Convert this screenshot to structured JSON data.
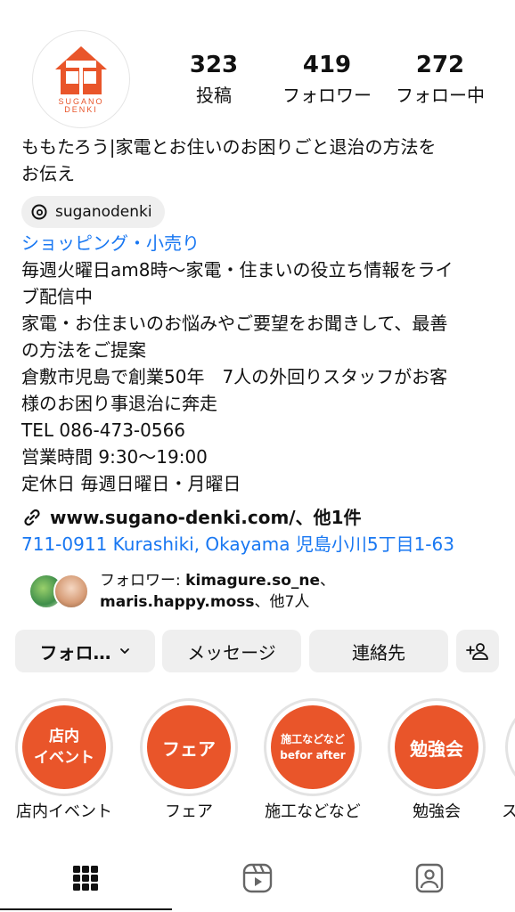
{
  "profile": {
    "logo_text_1": "SUGANO",
    "logo_text_2": "DENKI",
    "stats": [
      {
        "value": "323",
        "label": "投稿"
      },
      {
        "value": "419",
        "label": "フォロワー"
      },
      {
        "value": "272",
        "label": "フォロー中"
      }
    ]
  },
  "bio": {
    "name_line_1": "ももたろう|家電とお住いのお困りごと退治の方法を",
    "name_line_2": "お伝え",
    "threads_handle": "suganodenki",
    "category": "ショッピング・小売り",
    "lines": [
      "毎週火曜日am8時〜家電・住まいの役立ち情報をライ",
      "ブ配信中",
      "家電・お住まいのお悩みやご要望をお聞きして、最善",
      "の方法をご提案",
      "倉敷市児島で創業50年　7人の外回りスタッフがお客",
      "様のお困り事退治に奔走",
      "TEL 086-473-0566",
      "営業時間 9:30〜19:00",
      "定休日 毎週日曜日・月曜日"
    ],
    "link": "www.sugano-denki.com/、他1件",
    "address": "711-0911 Kurashiki, Okayama 児島小川5丁目1-63"
  },
  "followers": {
    "prefix": "フォロワー: ",
    "user1": "kimagure.so_ne",
    "sep": "、",
    "user2": "maris.happy.moss",
    "suffix": "、他7人"
  },
  "actions": {
    "follow_label": "フォロ…",
    "message_label": "メッセージ",
    "contact_label": "連絡先"
  },
  "highlights": [
    {
      "cover_line_1": "店内",
      "cover_line_2": "イベント",
      "label": "店内イベント"
    },
    {
      "cover_line_1": "フェア",
      "cover_line_2": "",
      "label": "フェア"
    },
    {
      "cover_line_1": "施工などなど",
      "cover_line_2": "befor after",
      "label": "施工などなど"
    },
    {
      "cover_line_1": "勉強会",
      "cover_line_2": "",
      "label": "勉強会"
    },
    {
      "cover_line_1": "",
      "cover_line_2": "",
      "label": "ス"
    }
  ],
  "tabs": [
    {
      "icon": "grid-icon",
      "active": true
    },
    {
      "icon": "reels-icon",
      "active": false
    },
    {
      "icon": "tagged-icon",
      "active": false
    }
  ],
  "colors": {
    "accent_orange": "#e9552a",
    "link_blue": "#1877f2",
    "button_bg": "#efefef"
  }
}
